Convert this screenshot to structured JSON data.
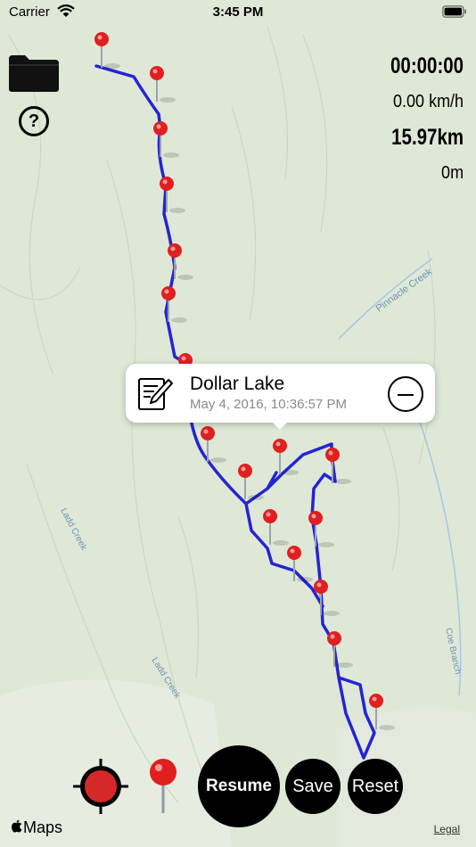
{
  "status_bar": {
    "carrier": "Carrier",
    "time": "3:45 PM"
  },
  "map": {
    "creek_labels": [
      "Pinnacle Creek",
      "Ladd Creek",
      "Ladd Creek",
      "Coe Branch"
    ],
    "track_color": "#2424d4",
    "pin_color": "#e02020",
    "background_color": "#dfe8d6"
  },
  "stats": {
    "elapsed": "00:00:00",
    "speed": "0.00 km/h",
    "distance": "15.97km",
    "altitude": "0m"
  },
  "help_label": "?",
  "callout": {
    "title": "Dollar Lake",
    "subtitle": "May 4, 2016, 10:36:57 PM"
  },
  "controls": {
    "resume": "Resume",
    "save": "Save",
    "reset": "Reset"
  },
  "footer": {
    "maps_logo": "Maps",
    "legal": "Legal"
  },
  "icons": [
    "wifi-icon",
    "battery-icon",
    "folder-icon",
    "help-icon",
    "edit-note-icon",
    "minus-circle-icon",
    "locate-icon",
    "drop-pin-icon",
    "apple-icon"
  ]
}
